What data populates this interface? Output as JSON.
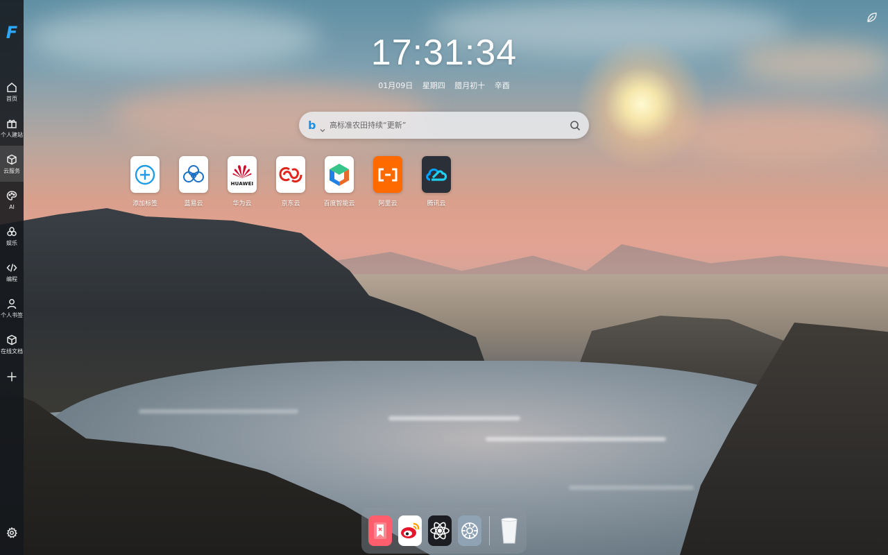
{
  "clock": {
    "time": "17:31:34"
  },
  "date": {
    "day": "01月09日",
    "weekday": "星期四",
    "lunar": "腊月初十",
    "ganzhi": "辛酉"
  },
  "search": {
    "placeholder": "高标准农田持续“更新”",
    "engine_icon": "bing-icon"
  },
  "sidebar": {
    "logo": "F",
    "items": [
      {
        "label": "首页",
        "icon": "home-icon"
      },
      {
        "label": "个人建站",
        "icon": "gift-icon"
      },
      {
        "label": "云服务",
        "icon": "cube-icon"
      },
      {
        "label": "AI",
        "icon": "palette-icon"
      },
      {
        "label": "娱乐",
        "icon": "circles-icon"
      },
      {
        "label": "编程",
        "icon": "code-icon"
      },
      {
        "label": "个人书签",
        "icon": "user-icon"
      },
      {
        "label": "在线文档",
        "icon": "box-icon"
      }
    ],
    "active_index": 2
  },
  "apps": [
    {
      "label": "添加标签",
      "icon": "add-icon"
    },
    {
      "label": "蓝易云",
      "icon": "lanyiyun-icon"
    },
    {
      "label": "华为云",
      "icon": "huawei-icon",
      "logo_text": "HUAWEI"
    },
    {
      "label": "京东云",
      "icon": "jdcloud-icon"
    },
    {
      "label": "百度智能云",
      "icon": "baiducloud-icon"
    },
    {
      "label": "阿里云",
      "icon": "aliyun-icon"
    },
    {
      "label": "腾讯云",
      "icon": "tencentcloud-icon"
    }
  ],
  "dock": [
    {
      "icon": "bookmark-app-icon"
    },
    {
      "icon": "weibo-icon"
    },
    {
      "icon": "react-icon"
    },
    {
      "icon": "system-settings-icon"
    },
    {
      "icon": "trash-icon"
    }
  ],
  "colors": {
    "accent": "#2aa9ff",
    "sidebar_bg": "#14181c",
    "aliyun": "#ff6a00",
    "huawei": "#cf0a2c"
  }
}
